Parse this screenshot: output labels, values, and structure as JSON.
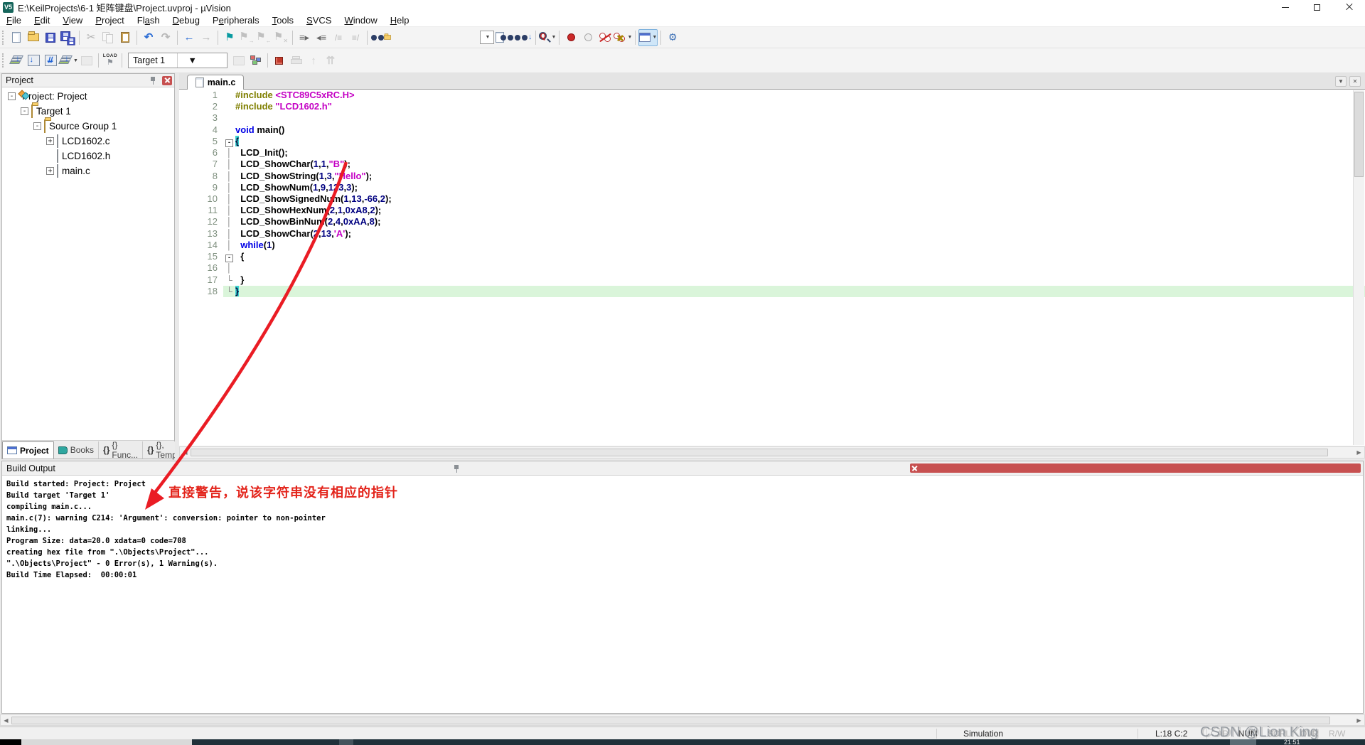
{
  "window": {
    "title": "E:\\KeilProjects\\6-1 矩阵键盘\\Project.uvproj - µVision"
  },
  "menu": {
    "items": [
      {
        "label": "File",
        "u": 0
      },
      {
        "label": "Edit",
        "u": 0
      },
      {
        "label": "View",
        "u": 0
      },
      {
        "label": "Project",
        "u": 0
      },
      {
        "label": "Flash",
        "u": 2
      },
      {
        "label": "Debug",
        "u": 0
      },
      {
        "label": "Peripherals",
        "u": 1
      },
      {
        "label": "Tools",
        "u": 0
      },
      {
        "label": "SVCS",
        "u": 0
      },
      {
        "label": "Window",
        "u": 0
      },
      {
        "label": "Help",
        "u": 0
      }
    ]
  },
  "toolbars": {
    "row1": [
      {
        "icon": "new-file"
      },
      {
        "icon": "open-file"
      },
      {
        "icon": "save"
      },
      {
        "icon": "save-all"
      },
      {
        "sep": true
      },
      {
        "icon": "cut",
        "gray": true
      },
      {
        "icon": "copy",
        "gray": true
      },
      {
        "icon": "paste"
      },
      {
        "sep": true
      },
      {
        "icon": "undo"
      },
      {
        "icon": "redo",
        "gray": true
      },
      {
        "sep": true
      },
      {
        "icon": "navigate-back"
      },
      {
        "icon": "navigate-forward",
        "gray": true
      },
      {
        "sep": true
      },
      {
        "icon": "insert-bookmark"
      },
      {
        "icon": "next-bookmark",
        "gray": true
      },
      {
        "icon": "prev-bookmark",
        "gray": true
      },
      {
        "icon": "clear-bookmarks",
        "gray": true
      },
      {
        "sep": true
      },
      {
        "icon": "indent"
      },
      {
        "icon": "unindent"
      },
      {
        "icon": "comment",
        "gray": true
      },
      {
        "icon": "uncomment",
        "gray": true
      },
      {
        "sep": true
      },
      {
        "icon": "find-in-files"
      },
      {
        "space": 120
      },
      {
        "icon": "search-combo"
      },
      {
        "icon": "find-in-files-doc"
      },
      {
        "icon": "incremental-find"
      },
      {
        "sep": true
      },
      {
        "icon": "debug-session",
        "dd": true
      },
      {
        "sep": true
      },
      {
        "icon": "breakpoint-toggle"
      },
      {
        "icon": "breakpoint-enable"
      },
      {
        "icon": "breakpoints-disable-all"
      },
      {
        "icon": "breakpoints-kill-all",
        "dd": true
      },
      {
        "sep": true
      },
      {
        "icon": "window-layout",
        "dd": true,
        "hl": true
      },
      {
        "sep": true
      },
      {
        "icon": "configure-wrench"
      }
    ],
    "row2": [
      {
        "icon": "translate-file"
      },
      {
        "icon": "build"
      },
      {
        "icon": "rebuild-all"
      },
      {
        "icon": "batch-build",
        "dd": true
      },
      {
        "icon": "stop-build",
        "gray": true
      },
      {
        "sep": true
      },
      {
        "icon": "download-load"
      },
      {
        "sep": true
      },
      {
        "combo": true
      },
      {
        "icon": "file-extensions",
        "gray": true
      },
      {
        "icon": "manage-project-items"
      },
      {
        "sep": true
      },
      {
        "icon": "red-cube",
        "gray": false
      },
      {
        "icon": "printer",
        "gray": true
      },
      {
        "icon": "arrow-up",
        "gray": true
      },
      {
        "icon": "double-arrow-up",
        "gray": true
      }
    ],
    "target_select": "Target 1",
    "load_label": "LOAD"
  },
  "project_panel": {
    "title": "Project",
    "tree": [
      {
        "label": "Project: Project",
        "level": 0,
        "expander": "minus",
        "icon": "chip"
      },
      {
        "label": "Target 1",
        "level": 1,
        "expander": "minus",
        "icon": "folder"
      },
      {
        "label": "Source Group 1",
        "level": 2,
        "expander": "minus",
        "icon": "folder"
      },
      {
        "label": "LCD1602.c",
        "level": 3,
        "expander": "plus",
        "icon": "file"
      },
      {
        "label": "LCD1602.h",
        "level": 3,
        "expander": "none",
        "icon": "file"
      },
      {
        "label": "main.c",
        "level": 3,
        "expander": "plus",
        "icon": "file"
      }
    ],
    "tabs": [
      {
        "label": "Project",
        "icon": "grid",
        "active": true
      },
      {
        "label": "Books",
        "icon": "book",
        "active": false
      },
      {
        "label": "{} Func...",
        "icon": "braces",
        "active": false
      },
      {
        "label": "{}, Temp...",
        "icon": "braces",
        "active": false
      }
    ]
  },
  "editor": {
    "tab_label": "main.c",
    "lines": [
      {
        "n": 1,
        "fold": "",
        "bg": "",
        "segs": [
          [
            "#include ",
            "dir"
          ],
          [
            "<STC89C5xRC.H>",
            "str"
          ]
        ]
      },
      {
        "n": 2,
        "fold": "",
        "bg": "",
        "segs": [
          [
            "#include ",
            "dir"
          ],
          [
            "\"LCD1602.h\"",
            "str"
          ]
        ]
      },
      {
        "n": 3,
        "fold": "",
        "bg": "",
        "segs": []
      },
      {
        "n": 4,
        "fold": "",
        "bg": "",
        "segs": [
          [
            "void",
            "kw"
          ],
          [
            " main()",
            "txt"
          ]
        ]
      },
      {
        "n": 5,
        "fold": "minus",
        "bg": "",
        "segs": [
          [
            "{",
            "bhl"
          ]
        ]
      },
      {
        "n": 6,
        "fold": "pipe",
        "bg": "",
        "segs": [
          [
            "  LCD_Init();",
            "txt"
          ]
        ]
      },
      {
        "n": 7,
        "fold": "pipe",
        "bg": "",
        "segs": [
          [
            "  LCD_ShowChar(",
            "txt"
          ],
          [
            "1",
            "num"
          ],
          [
            ",",
            "txt"
          ],
          [
            "1",
            "num"
          ],
          [
            ",",
            "txt"
          ],
          [
            "\"B\"",
            "str"
          ],
          [
            ");",
            "txt"
          ]
        ]
      },
      {
        "n": 8,
        "fold": "pipe",
        "bg": "",
        "segs": [
          [
            "  LCD_ShowString(",
            "txt"
          ],
          [
            "1",
            "num"
          ],
          [
            ",",
            "txt"
          ],
          [
            "3",
            "num"
          ],
          [
            ",",
            "txt"
          ],
          [
            "\"Hello\"",
            "str"
          ],
          [
            ");",
            "txt"
          ]
        ]
      },
      {
        "n": 9,
        "fold": "pipe",
        "bg": "",
        "segs": [
          [
            "  LCD_ShowNum(",
            "txt"
          ],
          [
            "1",
            "num"
          ],
          [
            ",",
            "txt"
          ],
          [
            "9",
            "num"
          ],
          [
            ",",
            "txt"
          ],
          [
            "123",
            "num"
          ],
          [
            ",",
            "txt"
          ],
          [
            "3",
            "num"
          ],
          [
            ");",
            "txt"
          ]
        ]
      },
      {
        "n": 10,
        "fold": "pipe",
        "bg": "",
        "segs": [
          [
            "  LCD_ShowSignedNum(",
            "txt"
          ],
          [
            "1",
            "num"
          ],
          [
            ",",
            "txt"
          ],
          [
            "13",
            "num"
          ],
          [
            ",",
            "txt"
          ],
          [
            "-66",
            "num"
          ],
          [
            ",",
            "txt"
          ],
          [
            "2",
            "num"
          ],
          [
            ");",
            "txt"
          ]
        ]
      },
      {
        "n": 11,
        "fold": "pipe",
        "bg": "",
        "segs": [
          [
            "  LCD_ShowHexNum(",
            "txt"
          ],
          [
            "2",
            "num"
          ],
          [
            ",",
            "txt"
          ],
          [
            "1",
            "num"
          ],
          [
            ",",
            "txt"
          ],
          [
            "0xA8",
            "num"
          ],
          [
            ",",
            "txt"
          ],
          [
            "2",
            "num"
          ],
          [
            ");",
            "txt"
          ]
        ]
      },
      {
        "n": 12,
        "fold": "pipe",
        "bg": "",
        "segs": [
          [
            "  LCD_ShowBinNum(",
            "txt"
          ],
          [
            "2",
            "num"
          ],
          [
            ",",
            "txt"
          ],
          [
            "4",
            "num"
          ],
          [
            ",",
            "txt"
          ],
          [
            "0xAA",
            "num"
          ],
          [
            ",",
            "txt"
          ],
          [
            "8",
            "num"
          ],
          [
            ");",
            "txt"
          ]
        ]
      },
      {
        "n": 13,
        "fold": "pipe",
        "bg": "",
        "segs": [
          [
            "  LCD_ShowChar(",
            "txt"
          ],
          [
            "2",
            "num"
          ],
          [
            ",",
            "txt"
          ],
          [
            "13",
            "num"
          ],
          [
            ",",
            "txt"
          ],
          [
            "'A'",
            "str"
          ],
          [
            ");",
            "txt"
          ]
        ]
      },
      {
        "n": 14,
        "fold": "pipe",
        "bg": "",
        "segs": [
          [
            "  ",
            "txt"
          ],
          [
            "while",
            "kw"
          ],
          [
            "(",
            "txt"
          ],
          [
            "1",
            "num"
          ],
          [
            ")",
            "txt"
          ]
        ]
      },
      {
        "n": 15,
        "fold": "minus",
        "bg": "",
        "segs": [
          [
            "  {",
            "txt"
          ]
        ]
      },
      {
        "n": 16,
        "fold": "pipe",
        "bg": "",
        "segs": []
      },
      {
        "n": 17,
        "fold": "corner",
        "bg": "",
        "segs": [
          [
            "  }",
            "txt"
          ]
        ]
      },
      {
        "n": 18,
        "fold": "corner",
        "bg": "current",
        "segs": [
          [
            "}",
            "bhl"
          ]
        ]
      }
    ]
  },
  "build_output": {
    "title": "Build Output",
    "lines": [
      "Build started: Project: Project",
      "Build target 'Target 1'",
      "compiling main.c...",
      "main.c(7): warning C214: 'Argument': conversion: pointer to non-pointer",
      "linking...",
      "Program Size: data=20.0 xdata=0 code=708",
      "creating hex file from \".\\Objects\\Project\"...",
      "\".\\Objects\\Project\" - 0 Error(s), 1 Warning(s).",
      "Build Time Elapsed:  00:00:01"
    ]
  },
  "annotation": {
    "text": "直接警告，说该字符串没有相应的指针",
    "color": "#e3241b"
  },
  "status_bar": {
    "simulation": "Simulation",
    "cursor": "L:18 C:2",
    "indicators": [
      {
        "label": "CAP",
        "on": false
      },
      {
        "label": "NUM",
        "on": true
      },
      {
        "label": "SCRL",
        "on": false
      },
      {
        "label": "OVR",
        "on": false
      },
      {
        "label": "R/W",
        "on": false
      }
    ],
    "watermark": "CSDN @Lion King",
    "taskbar_time": "21:51"
  },
  "colors": {
    "keyword": "#0000e6",
    "string": "#c400c4",
    "number": "#000080",
    "directive": "#7f7f00",
    "current_line_bg": "#daf5da",
    "brace_match_bg": "#3ed2d2",
    "annotation_red": "#e3241b",
    "close_button_red": "#c75050"
  }
}
